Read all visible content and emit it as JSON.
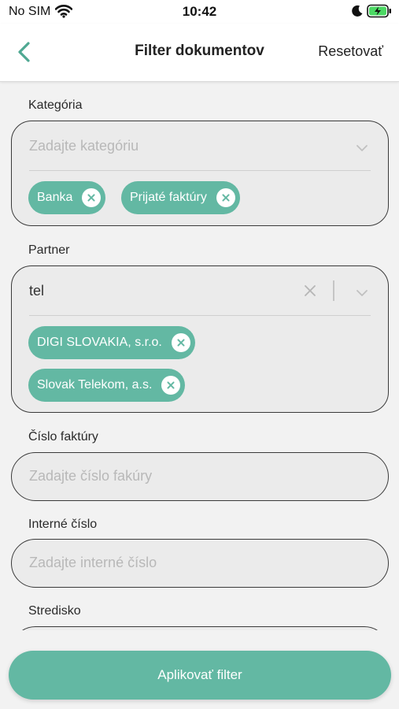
{
  "status_bar": {
    "carrier": "No SIM",
    "time": "10:42"
  },
  "nav": {
    "title": "Filter dokumentov",
    "reset_label": "Resetovať"
  },
  "category": {
    "label": "Kategória",
    "placeholder": "Zadajte kategóriu",
    "chips": [
      "Banka",
      "Prijaté faktúry"
    ]
  },
  "partner": {
    "label": "Partner",
    "value": "tel",
    "chips": [
      "DIGI SLOVAKIA, s.r.o.",
      "Slovak Telekom, a.s."
    ]
  },
  "invoice_number": {
    "label": "Číslo faktúry",
    "placeholder": "Zadajte číslo fakúry"
  },
  "internal_number": {
    "label": "Interné číslo",
    "placeholder": "Zadajte interné číslo"
  },
  "cost_center": {
    "label": "Stredisko"
  },
  "apply_label": "Aplikovať filter",
  "colors": {
    "accent": "#63b8a3",
    "back_arrow": "#4fa892",
    "field_border": "#3a3a3a",
    "field_bg": "#ebebeb"
  },
  "icons": [
    "wifi-icon",
    "moon-icon",
    "battery-charging-icon",
    "back-arrow-icon",
    "chevron-down-icon",
    "close-icon",
    "chip-remove-icon"
  ]
}
